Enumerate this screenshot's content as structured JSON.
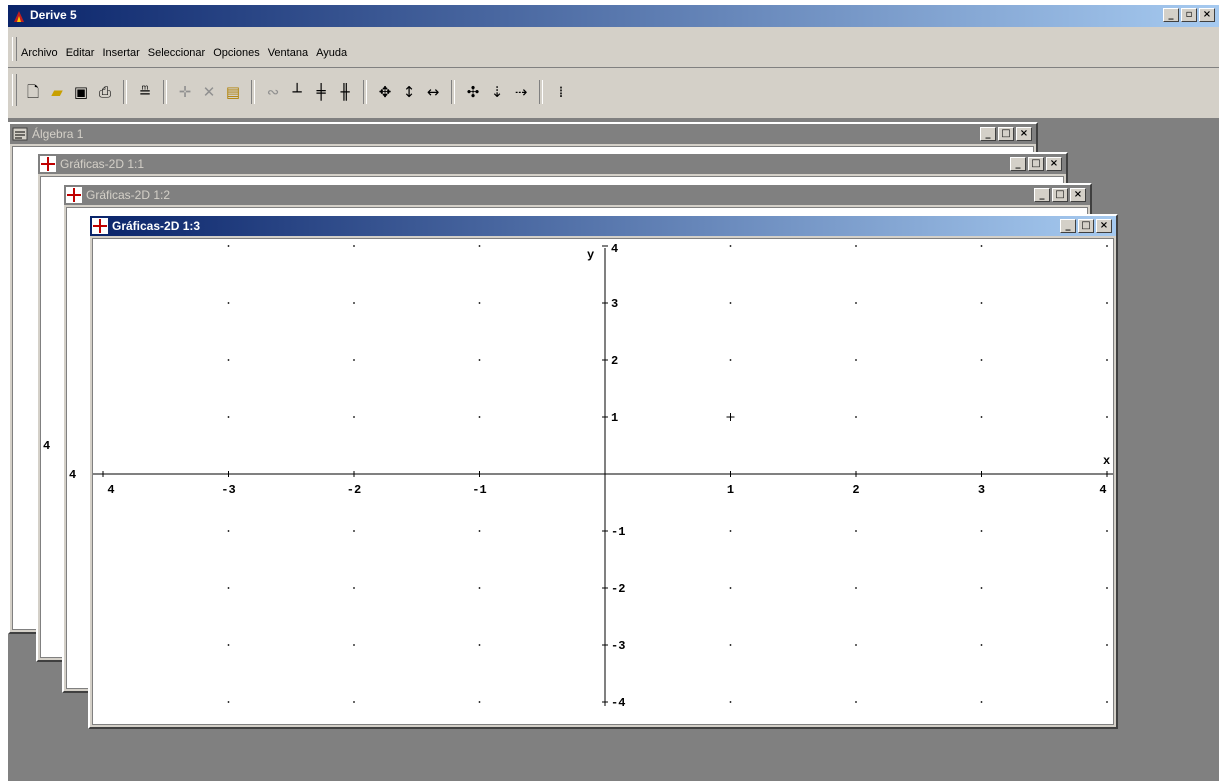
{
  "app": {
    "title": "Derive 5",
    "title_buttons": [
      "_",
      "▫",
      "×"
    ]
  },
  "menu": {
    "items": [
      "Archivo",
      "Editar",
      "Insertar",
      "Seleccionar",
      "Opciones",
      "Ventana",
      "Ayuda"
    ]
  },
  "toolbar": {
    "icons": [
      "new-file-icon",
      "open-folder-icon",
      "save-icon",
      "print-icon",
      "author-expression-icon",
      "plot-point-icon",
      "delete-plot-icon",
      "annotate-icon",
      "trace-icon",
      "center-origin-icon",
      "set-range-icon",
      "set-range-2-icon",
      "zoom-in-both-icon",
      "zoom-in-vertical-icon",
      "zoom-in-horizontal-icon",
      "zoom-out-both-icon",
      "zoom-out-vertical-icon",
      "zoom-out-horizontal-icon",
      "algebra-window-icon"
    ]
  },
  "windows": [
    {
      "title": "Álgebra 1",
      "active": false
    },
    {
      "title": "Gráficas-2D 1:1",
      "active": false,
      "edge_label": "4"
    },
    {
      "title": "Gráficas-2D 1:2",
      "active": false,
      "edge_label": "4"
    },
    {
      "title": "Gráficas-2D 1:3",
      "active": true
    }
  ],
  "window_buttons": [
    "_",
    "□",
    "×"
  ],
  "plot": {
    "x_label": "x",
    "y_label": "y",
    "x_range": [
      -4,
      4
    ],
    "y_range": [
      -4,
      4
    ],
    "x_ticks": [
      "4",
      "-3",
      "-2",
      "-1",
      "1",
      "2",
      "3",
      "4"
    ],
    "x_tick_values": [
      -4,
      -3,
      -2,
      -1,
      1,
      2,
      3,
      4
    ],
    "y_ticks": [
      "4",
      "3",
      "2",
      "1",
      "-1",
      "-2",
      "-3",
      "-4"
    ],
    "y_tick_values": [
      4,
      3,
      2,
      1,
      -1,
      -2,
      -3,
      -4
    ],
    "grid": "dots",
    "cross_marker": {
      "x": 1,
      "y": 1
    }
  }
}
